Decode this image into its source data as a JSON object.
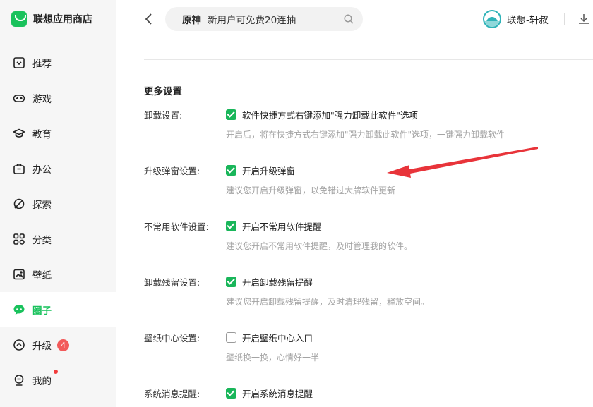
{
  "app": {
    "name": "联想应用商店"
  },
  "sidebar": {
    "items": [
      {
        "label": "推荐",
        "icon": "recommend-icon"
      },
      {
        "label": "游戏",
        "icon": "gamepad-icon"
      },
      {
        "label": "教育",
        "icon": "graduation-cap-icon"
      },
      {
        "label": "办公",
        "icon": "briefcase-icon"
      },
      {
        "label": "探索",
        "icon": "explore-icon"
      },
      {
        "label": "分类",
        "icon": "category-grid-icon"
      },
      {
        "label": "壁纸",
        "icon": "wallpaper-icon"
      },
      {
        "label": "圈子",
        "icon": "chat-bubble-icon",
        "active": true
      },
      {
        "label": "升级",
        "icon": "upgrade-icon",
        "badge": "4"
      },
      {
        "label": "我的",
        "icon": "user-icon",
        "dot": true
      }
    ]
  },
  "header": {
    "search": {
      "keyword": "原神",
      "text": "新用户可免费20连抽"
    },
    "user": {
      "name": "联想-轩叔"
    }
  },
  "settings": {
    "section_title": "更多设置",
    "rows": [
      {
        "label": "卸载设置:",
        "option": "软件快捷方式右键添加\"强力卸载此软件\"选项",
        "checked": true,
        "desc": "开启后，将在快捷方式右键添加\"强力卸载此软件\"选项，一键强力卸载软件"
      },
      {
        "label": "升级弹窗设置:",
        "option": "开启升级弹窗",
        "checked": true,
        "desc": "建议您开启升级弹窗，以免错过大牌软件更新"
      },
      {
        "label": "不常用软件设置:",
        "option": "开启不常用软件提醒",
        "checked": true,
        "desc": "建议您开启不常用软件提醒，及时管理我的软件。"
      },
      {
        "label": "卸载残留设置:",
        "option": "开启卸载残留提醒",
        "checked": true,
        "desc": "建议您开启卸载残留提醒，及时清理残留，释放空间。"
      },
      {
        "label": "壁纸中心设置:",
        "option": "开启壁纸中心入口",
        "checked": false,
        "desc": "壁纸换一换，心情好一半"
      },
      {
        "label": "系统消息提醒:",
        "option": "开启系统消息提醒",
        "checked": true,
        "desc": ""
      }
    ]
  },
  "colors": {
    "accent": "#19c25c",
    "badge": "#f25a5a",
    "annotation_arrow": "#e8343a"
  }
}
